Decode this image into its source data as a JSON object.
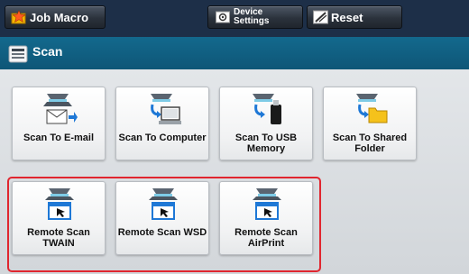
{
  "topbar": {
    "job_macro": {
      "label": "Job Macro",
      "icon": "star-folder-icon"
    },
    "device_settings": {
      "label_line1": "Device",
      "label_line2": "Settings",
      "icon": "device-settings-icon"
    },
    "reset": {
      "label": "Reset",
      "icon": "reset-icon"
    }
  },
  "title": {
    "text": "Scan",
    "icon": "scanner-icon"
  },
  "tiles": [
    {
      "label": "Scan To E-mail",
      "icon": "scan-to-email-icon"
    },
    {
      "label": "Scan To Computer",
      "icon": "scan-to-computer-icon"
    },
    {
      "label": "Scan To USB",
      "label2": "Memory",
      "icon": "scan-to-usb-icon"
    },
    {
      "label": "Scan To Shared",
      "label2": "Folder",
      "icon": "scan-to-shared-folder-icon"
    },
    {
      "label": "Remote Scan",
      "label2": "TWAIN",
      "icon": "remote-scan-icon"
    },
    {
      "label": "Remote Scan WSD",
      "icon": "remote-scan-icon"
    },
    {
      "label": "Remote Scan",
      "label2": "AirPrint",
      "icon": "remote-scan-icon"
    }
  ],
  "colors": {
    "topbar": "#1d2f48",
    "titlebar": "#0e5c80",
    "highlight": "#e0262f"
  }
}
